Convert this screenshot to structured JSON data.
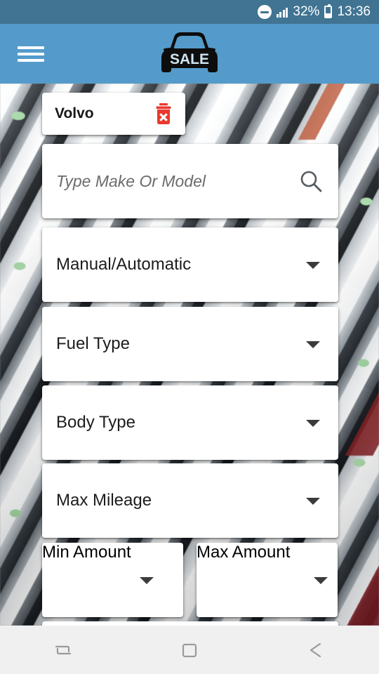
{
  "status_bar": {
    "dnd_icon": "do-not-disturb-icon",
    "signal_icon": "cellular-signal-icon",
    "battery_percent": "32%",
    "battery_icon": "battery-icon",
    "time": "13:36",
    "background_color": "#407492",
    "text_color": "#ffffff"
  },
  "app_bar": {
    "menu_icon": "hamburger-menu-icon",
    "logo": {
      "icon": "car-sale-logo-icon",
      "text": "SALE",
      "color": "#101010"
    },
    "background_color": "#549BCB"
  },
  "filters": {
    "selected_make": {
      "label": "Volvo",
      "delete_icon": "trash-delete-icon",
      "delete_color": "#E8392E"
    },
    "search": {
      "value": "",
      "placeholder": "Type Make Or Model",
      "icon": "search-icon"
    },
    "dropdowns": [
      {
        "id": "transmission",
        "label": "Manual/Automatic",
        "icon": "chevron-down-icon"
      },
      {
        "id": "fuel",
        "label": "Fuel Type",
        "icon": "chevron-down-icon"
      },
      {
        "id": "body",
        "label": "Body Type",
        "icon": "chevron-down-icon"
      },
      {
        "id": "mileage",
        "label": "Max Mileage",
        "icon": "chevron-down-icon"
      }
    ],
    "amount_row": [
      {
        "id": "min_amount",
        "label": "Min Amount",
        "icon": "chevron-down-icon"
      },
      {
        "id": "max_amount",
        "label": "Max Amount",
        "icon": "chevron-down-icon"
      }
    ]
  },
  "nav_bar": {
    "items": [
      {
        "name": "recents",
        "icon": "recents-icon"
      },
      {
        "name": "home",
        "icon": "home-square-icon"
      },
      {
        "name": "back",
        "icon": "back-arrow-icon"
      }
    ],
    "background_color": "#f0f0f0",
    "icon_color": "#9a9a9a"
  }
}
